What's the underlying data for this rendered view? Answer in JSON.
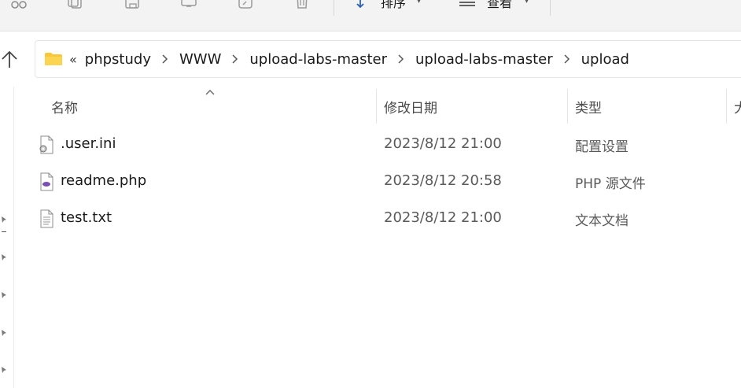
{
  "toolbar": {
    "icons": [
      "cut-icon",
      "copy-icon",
      "paste-icon",
      "rename-icon",
      "share-icon",
      "delete-icon"
    ],
    "sort_label": "排序",
    "view_label": "查看",
    "more_label": "···"
  },
  "navigation": {
    "up_icon": "arrow-up-icon"
  },
  "address_bar": {
    "folder_icon": "folder-icon",
    "overflow": "«",
    "crumbs": [
      "phpstudy",
      "WWW",
      "upload-labs-master",
      "upload-labs-master",
      "upload"
    ]
  },
  "columns": {
    "name": "名称",
    "modified": "修改日期",
    "type": "类型",
    "size": "大"
  },
  "files": [
    {
      "name": ".user.ini",
      "modified": "2023/8/12 21:00",
      "type": "配置设置",
      "icon": "settings-file-icon"
    },
    {
      "name": "readme.php",
      "modified": "2023/8/12 20:58",
      "type": "PHP 源文件",
      "icon": "php-file-icon"
    },
    {
      "name": "test.txt",
      "modified": "2023/8/12 21:00",
      "type": "文本文档",
      "icon": "text-file-icon"
    }
  ],
  "colors": {
    "accent_folder": "#f8c83a",
    "toolbar_bg": "#f3f3f3",
    "php_purple": "#7a4fb3"
  }
}
